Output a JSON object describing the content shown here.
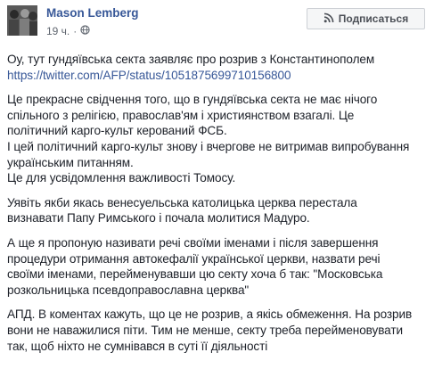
{
  "author": "Mason Lemberg",
  "timestamp": "19 ч.",
  "separator": "·",
  "privacy_icon": "globe-icon",
  "subscribe_label": "Подписаться",
  "subscribe_icon": "rss-icon",
  "colors": {
    "link": "#385898",
    "text": "#1d2129",
    "meta": "#616770"
  },
  "paragraphs": [
    [
      "Оу, тут гундяївська секта заявляє про розрив з Константинополем",
      "https://twitter.com/AFP/status/1051875699710156800"
    ],
    [
      "Це прекрасне свідчення того, що в гундяївська секта не має нічого",
      "спільного з релігією, православ'ям і християнством взагалі. Це",
      "політичний карго-культ керований ФСБ.",
      "І цей політичний карго-культ знову і вчергове не витримав випробування",
      "українським питанням.",
      "Це для усвідомлення важливості Томосу."
    ],
    [
      "Уявіть якби якась венесуельська католицька церква перестала",
      "визнавати Папу Римського і почала молитися Мадуро."
    ],
    [
      "А ще я пропоную називати речі своїми іменами і після завершення",
      "процедури отримання автокефалії української церкви, назвати речі",
      "своїми іменами, перейменувавши цю секту хоча б так: \"Московська",
      "розкольницька псевдоправославна церква\""
    ],
    [
      "АПД. В коментах кажуть, що це не розрив, а якісь обмеження. На розрив",
      "вони не наважилися піти. Тим не менше, секту треба перейменовувати",
      "так, щоб ніхто не сумнівався в суті її діяльності"
    ]
  ]
}
